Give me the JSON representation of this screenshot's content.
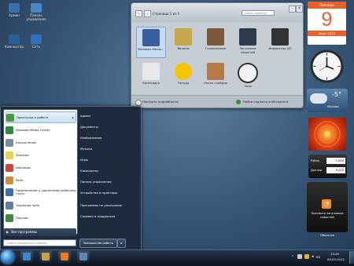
{
  "desktop_icons": [
    {
      "label": "Админ",
      "icon": "user-folder-icon",
      "color": "#3a6fb0"
    },
    {
      "label": "Панель управления",
      "icon": "control-panel-icon",
      "color": "#4d86c6"
    },
    {
      "label": "Компьютер",
      "icon": "computer-icon",
      "color": "#2b5e9a"
    },
    {
      "label": "Сеть",
      "icon": "network-icon",
      "color": "#2f70b8"
    }
  ],
  "gadget_window": {
    "pager_text": "Страница 1 из 1",
    "search_placeholder": "Найти гаджеты",
    "tiles": [
      {
        "label": "Windows Media...",
        "icon": "media-center-icon",
        "color": "#3b5f9d",
        "selected": true
      },
      {
        "label": "Валюта",
        "icon": "currency-icon",
        "color": "#c9a84b",
        "selected": false
      },
      {
        "label": "Головоломка",
        "icon": "puzzle-icon",
        "color": "#7a5a3a",
        "selected": false
      },
      {
        "label": "Заголовки новостей",
        "icon": "news-icon",
        "color": "#2c3a4c",
        "selected": false
      },
      {
        "label": "Индикатор ЦП",
        "icon": "cpu-meter-icon",
        "color": "#333333",
        "selected": false
      },
      {
        "label": "Календарь",
        "icon": "calendar-icon",
        "color": "#e8e8e8",
        "selected": false
      },
      {
        "label": "Погода",
        "icon": "weather-sun-icon",
        "color": "#f5c400",
        "selected": false
      },
      {
        "label": "Показ слайдов",
        "icon": "slideshow-icon",
        "color": "#b37a45",
        "selected": false
      },
      {
        "label": "Часы",
        "icon": "clock-icon",
        "color": "#f2f2f2",
        "selected": false
      }
    ],
    "show_details": "Показать подробности",
    "online_link": "Найти гаджеты в Интернете"
  },
  "calendar_gadget": {
    "top": "Пятница",
    "day": "9",
    "bottom": "Март 2012"
  },
  "weather_gadget": {
    "temp": "-5°",
    "city": "Москва"
  },
  "currency_gadget": {
    "rows": [
      {
        "name": "Рубль",
        "value": "1,000"
      },
      {
        "name": "Доллар",
        "value": "0,025"
      }
    ]
  },
  "feed_gadget": {
    "title": "Просмотр заголовков новостей"
  },
  "feed_footer": "Оболочка",
  "start_menu": {
    "left_items": [
      {
        "label": "Приступая к работе",
        "icon": "getting-started-icon",
        "color": "#4b9a3f",
        "arrow": true
      },
      {
        "label": "Windows Media Center",
        "icon": "media-center-icon",
        "color": "#2a8c3c",
        "arrow": false
      },
      {
        "label": "Калькулятор",
        "icon": "calculator-icon",
        "color": "#7c8a99",
        "arrow": false
      },
      {
        "label": "Записки",
        "icon": "sticky-notes-icon",
        "color": "#e7d44a",
        "arrow": false
      },
      {
        "label": "Ножницы",
        "icon": "scissors-icon",
        "color": "#d2443b",
        "arrow": false
      },
      {
        "label": "Paint",
        "icon": "paint-icon",
        "color": "#d28b3a",
        "arrow": false
      },
      {
        "label": "Подключение к удаленному рабочему столу",
        "icon": "remote-desktop-icon",
        "color": "#3b6ea8",
        "arrow": false
      },
      {
        "label": "Экранная лупа",
        "icon": "magnifier-icon",
        "color": "#5d7fa6",
        "arrow": false
      },
      {
        "label": "Пасьянс",
        "icon": "solitaire-icon",
        "color": "#3c8a3c",
        "arrow": false
      }
    ],
    "all_programs": "Все программы",
    "search_placeholder": "Найти программы и файлы",
    "right_items": [
      "Админ",
      "Документы",
      "Изображения",
      "Музыка",
      "Игры",
      "Компьютер",
      "Панель управления",
      "Устройства и принтеры",
      "Программы по умолчанию",
      "Справка и поддержка"
    ],
    "shutdown_label": "Завершение работы"
  },
  "taskbar": {
    "pinned": [
      {
        "name": "ie-icon",
        "color": "#3b86d1"
      },
      {
        "name": "explorer-icon",
        "color": "#caa145"
      },
      {
        "name": "media-player-icon",
        "color": "#f07a1a"
      },
      {
        "name": "computer-icon",
        "color": "#5d86b5"
      }
    ],
    "lang": "RU",
    "time": "13:29",
    "date": "09.03.2012"
  }
}
